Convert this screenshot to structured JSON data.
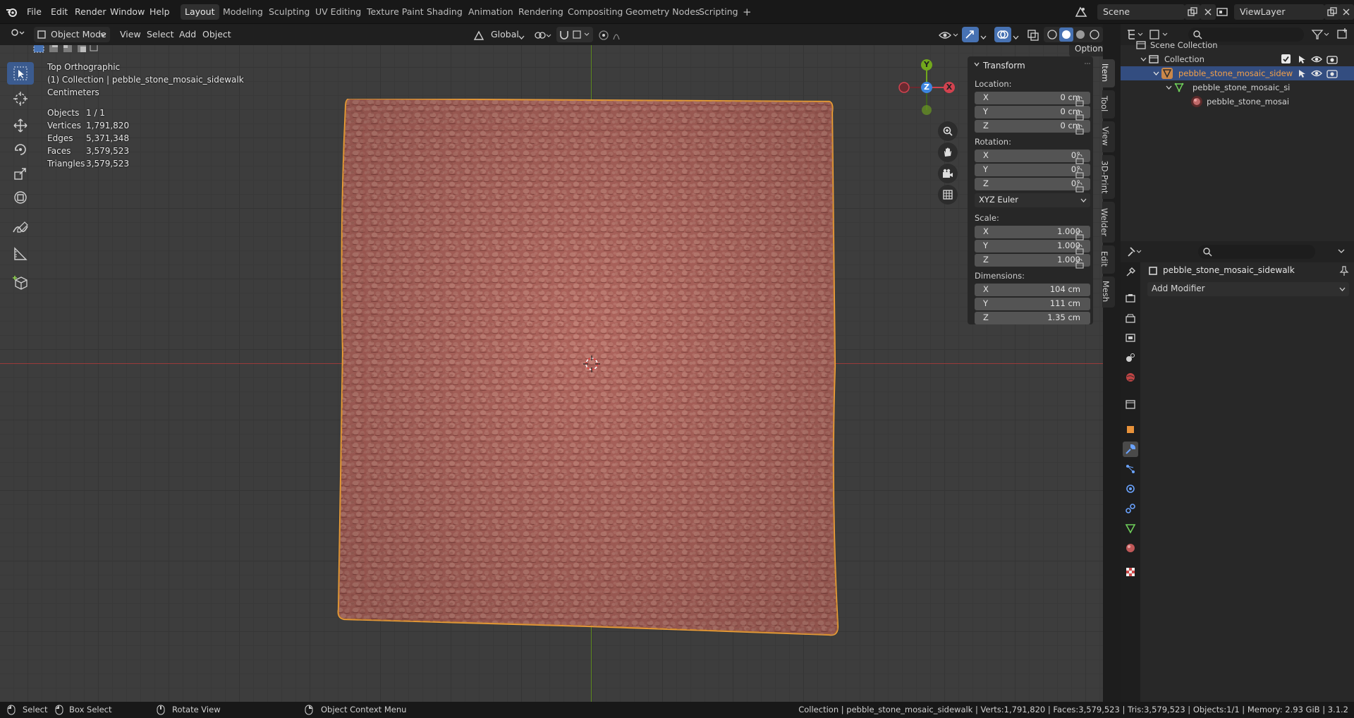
{
  "menu": {
    "items": [
      "File",
      "Edit",
      "Render",
      "Window",
      "Help"
    ],
    "workspaces": [
      "Layout",
      "Modeling",
      "Sculpting",
      "UV Editing",
      "Texture Paint",
      "Shading",
      "Animation",
      "Rendering",
      "Compositing",
      "Geometry Nodes",
      "Scripting"
    ],
    "active_workspace": "Layout",
    "add_tab": "+",
    "scene": "Scene",
    "view_layer": "ViewLayer"
  },
  "header": {
    "mode": "Object Mode",
    "view": "View",
    "select": "Select",
    "add": "Add",
    "object": "Object",
    "orientation": "Global",
    "options": "Options"
  },
  "overlay_info": {
    "view_name": "Top Orthographic",
    "collection_line": "(1) Collection | pebble_stone_mosaic_sidewalk",
    "units": "Centimeters",
    "stats": [
      {
        "label": "Objects",
        "value": "1 / 1"
      },
      {
        "label": "Vertices",
        "value": "1,791,820"
      },
      {
        "label": "Edges",
        "value": "5,371,348"
      },
      {
        "label": "Faces",
        "value": "3,579,523"
      },
      {
        "label": "Triangles",
        "value": "3,579,523"
      }
    ]
  },
  "gizmo": {
    "x": "X",
    "y": "Y",
    "z": "Z"
  },
  "transform": {
    "title": "Transform",
    "location_label": "Location:",
    "location": [
      {
        "axis": "X",
        "value": "0 cm"
      },
      {
        "axis": "Y",
        "value": "0 cm"
      },
      {
        "axis": "Z",
        "value": "0 cm"
      }
    ],
    "rotation_label": "Rotation:",
    "rotation": [
      {
        "axis": "X",
        "value": "0°"
      },
      {
        "axis": "Y",
        "value": "0°"
      },
      {
        "axis": "Z",
        "value": "0°"
      }
    ],
    "rotation_mode": "XYZ Euler",
    "scale_label": "Scale:",
    "scale": [
      {
        "axis": "X",
        "value": "1.000"
      },
      {
        "axis": "Y",
        "value": "1.000"
      },
      {
        "axis": "Z",
        "value": "1.000"
      }
    ],
    "dimensions_label": "Dimensions:",
    "dimensions": [
      {
        "axis": "X",
        "value": "104 cm"
      },
      {
        "axis": "Y",
        "value": "111 cm"
      },
      {
        "axis": "Z",
        "value": "1.35 cm"
      }
    ]
  },
  "sidebar_tabs": [
    "Item",
    "Tool",
    "View",
    "3D-Print",
    "Welder",
    "Edit",
    "Mesh"
  ],
  "outliner": {
    "scene_collection": "Scene Collection",
    "collection": "Collection",
    "object": "pebble_stone_mosaic_sidew",
    "mesh": "pebble_stone_mosaic_si",
    "material": "pebble_stone_mosai"
  },
  "properties": {
    "object_name": "pebble_stone_mosaic_sidewalk",
    "add_modifier": "Add Modifier"
  },
  "status": {
    "select": "Select",
    "box_select": "Box Select",
    "rotate_view": "Rotate View",
    "context_menu": "Object Context Menu",
    "info": "Collection | pebble_stone_mosaic_sidewalk | Verts:1,791,820 | Faces:3,579,523 | Tris:3,579,523 | Objects:1/1 | Memory: 2.93 GiB | 3.1.2"
  },
  "colors": {
    "accent": "#4772b3",
    "selection_outline": "#f5a33a",
    "mesh": "#b86a62",
    "x_axis": "#d2424f",
    "y_axis": "#72a81c",
    "z_axis": "#3d86e0"
  }
}
